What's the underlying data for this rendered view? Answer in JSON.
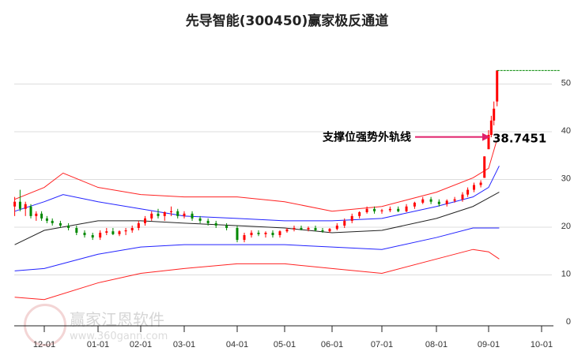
{
  "title": "先导智能(300450)赢家极反通道",
  "watermark": {
    "name": "赢家江恩软件",
    "url": "www.360gann.com"
  },
  "chart_data": {
    "type": "candlestick",
    "title": "先导智能(300450)赢家极反通道",
    "x_ticks": [
      "12-01",
      "01-01",
      "02-01",
      "03-01",
      "04-01",
      "05-01",
      "06-01",
      "07-01",
      "08-01",
      "09-01",
      "10-01"
    ],
    "y_ticks": [
      0,
      10,
      20,
      30,
      40,
      50
    ],
    "ylim": [
      0,
      55
    ],
    "x_unit": "months since 12-01",
    "annotation": {
      "label": "支撑位强势外轨线",
      "value": "38.7451"
    },
    "target_line": 53.5,
    "bands": {
      "upper_red": [
        [
          -0.55,
          26.5
        ],
        [
          0,
          29
        ],
        [
          0.35,
          32
        ],
        [
          1,
          29
        ],
        [
          2,
          27.5
        ],
        [
          3,
          27
        ],
        [
          4,
          27
        ],
        [
          5,
          26
        ],
        [
          6,
          24
        ],
        [
          7,
          25
        ],
        [
          8,
          28
        ],
        [
          8.7,
          31
        ],
        [
          9,
          33
        ],
        [
          9.15,
          38.7
        ]
      ],
      "upper_blue": [
        [
          -0.55,
          24
        ],
        [
          0,
          26
        ],
        [
          0.35,
          27.5
        ],
        [
          1,
          26
        ],
        [
          2,
          24.5
        ],
        [
          3,
          23
        ],
        [
          4,
          22.5
        ],
        [
          5,
          22
        ],
        [
          6,
          22
        ],
        [
          7,
          22.5
        ],
        [
          8,
          25
        ],
        [
          8.7,
          27
        ],
        [
          9,
          29
        ],
        [
          9.2,
          33.5
        ]
      ],
      "middle_black": [
        [
          -0.55,
          17
        ],
        [
          0,
          20
        ],
        [
          1,
          22
        ],
        [
          2,
          22
        ],
        [
          3,
          21.5
        ],
        [
          4,
          21
        ],
        [
          5,
          20.5
        ],
        [
          6,
          19.5
        ],
        [
          7,
          20
        ],
        [
          8,
          22.5
        ],
        [
          8.7,
          25
        ],
        [
          9.2,
          28
        ]
      ],
      "lower_blue": [
        [
          -0.55,
          11.5
        ],
        [
          0,
          12
        ],
        [
          1,
          15
        ],
        [
          2,
          16.5
        ],
        [
          3,
          17
        ],
        [
          4,
          17
        ],
        [
          5,
          17
        ],
        [
          6,
          16.5
        ],
        [
          7,
          16
        ],
        [
          8,
          18.5
        ],
        [
          8.7,
          20.5
        ],
        [
          9.2,
          20.5
        ]
      ],
      "lower_red": [
        [
          -0.55,
          6
        ],
        [
          0,
          5.5
        ],
        [
          1,
          9
        ],
        [
          2,
          11
        ],
        [
          3,
          12
        ],
        [
          4,
          13
        ],
        [
          5,
          13
        ],
        [
          6,
          12
        ],
        [
          7,
          11
        ],
        [
          8,
          14
        ],
        [
          8.7,
          16
        ],
        [
          9,
          15.5
        ],
        [
          9.2,
          14
        ]
      ]
    },
    "candles": [
      [
        -0.55,
        25,
        27,
        23,
        26
      ],
      [
        -0.45,
        26,
        28.5,
        24,
        24.5
      ],
      [
        -0.35,
        24.5,
        26,
        23,
        25.5
      ],
      [
        -0.25,
        25,
        25.5,
        22.5,
        23
      ],
      [
        -0.15,
        23,
        24,
        22,
        23.5
      ],
      [
        -0.05,
        23.5,
        24,
        22,
        22.5
      ],
      [
        0.05,
        22.5,
        23,
        21.5,
        22
      ],
      [
        0.15,
        22,
        22.5,
        21,
        21.5
      ],
      [
        0.3,
        21.5,
        22,
        20.5,
        21
      ],
      [
        0.45,
        21,
        21.5,
        20,
        20.5
      ],
      [
        0.6,
        20.5,
        21,
        19,
        19.5
      ],
      [
        0.75,
        19.5,
        20,
        18.5,
        19
      ],
      [
        0.9,
        19,
        19.5,
        18,
        18.5
      ],
      [
        1.05,
        18.5,
        20,
        18,
        19.5
      ],
      [
        1.2,
        19.5,
        20.5,
        19,
        19.8
      ],
      [
        1.35,
        19.8,
        20.5,
        19,
        19.2
      ],
      [
        1.5,
        19.2,
        20,
        18.8,
        19.8
      ],
      [
        1.65,
        19.8,
        20.5,
        19,
        20
      ],
      [
        1.8,
        20,
        21,
        19.5,
        20.5
      ],
      [
        1.95,
        20.5,
        22,
        20,
        21.5
      ],
      [
        2.1,
        21.5,
        23,
        21,
        22.5
      ],
      [
        2.25,
        22.5,
        24,
        22,
        23.5
      ],
      [
        2.4,
        23.5,
        24.5,
        22.5,
        23
      ],
      [
        2.55,
        23,
        24,
        22,
        23.8
      ],
      [
        2.7,
        23.8,
        25,
        23,
        24
      ],
      [
        2.85,
        24,
        24.5,
        22.5,
        23
      ],
      [
        3.0,
        23,
        24,
        22.5,
        23.5
      ],
      [
        3.15,
        23.5,
        24,
        22,
        22.5
      ],
      [
        3.3,
        22.5,
        23,
        21.5,
        22
      ],
      [
        3.45,
        22,
        22.5,
        21,
        21.5
      ],
      [
        3.6,
        21.5,
        22,
        20.5,
        21
      ],
      [
        3.8,
        21,
        21.5,
        20,
        20.5
      ],
      [
        4.0,
        20.5,
        21,
        17.5,
        18
      ],
      [
        4.15,
        18,
        19.5,
        17.5,
        19
      ],
      [
        4.3,
        19,
        20,
        18.5,
        19.5
      ],
      [
        4.45,
        19.5,
        20,
        18.8,
        19.2
      ],
      [
        4.6,
        19.2,
        19.8,
        18.5,
        19.5
      ],
      [
        4.75,
        19.5,
        20,
        18.5,
        19
      ],
      [
        4.9,
        19,
        20,
        18.5,
        19.8
      ],
      [
        5.05,
        19.8,
        20.5,
        19.5,
        20.2
      ],
      [
        5.2,
        20.2,
        21,
        19.8,
        20.5
      ],
      [
        5.35,
        20.5,
        21,
        20,
        20.2
      ],
      [
        5.5,
        20.2,
        20.8,
        19.8,
        20.5
      ],
      [
        5.65,
        20.5,
        21,
        19.8,
        20
      ],
      [
        5.8,
        20,
        20.5,
        19.5,
        19.8
      ],
      [
        5.95,
        19.8,
        20.5,
        19.5,
        20.3
      ],
      [
        6.1,
        20.3,
        21.5,
        20,
        21
      ],
      [
        6.25,
        21,
        22.5,
        20.5,
        22
      ],
      [
        6.4,
        22,
        23.5,
        21.5,
        23
      ],
      [
        6.55,
        23,
        24,
        22.5,
        23.8
      ],
      [
        6.7,
        23.8,
        25,
        23.5,
        24.5
      ],
      [
        6.85,
        24.5,
        25,
        23.5,
        24
      ],
      [
        7.0,
        24,
        24.5,
        23.5,
        24.2
      ],
      [
        7.15,
        24.2,
        25,
        23.8,
        24.5
      ],
      [
        7.3,
        24.5,
        25,
        23.8,
        24
      ],
      [
        7.45,
        24,
        25.5,
        23.8,
        25
      ],
      [
        7.6,
        25,
        26,
        24.5,
        25.8
      ],
      [
        7.75,
        25.8,
        27,
        25.5,
        26.5
      ],
      [
        7.9,
        26.5,
        27,
        25.5,
        26
      ],
      [
        8.05,
        26,
        26.5,
        25,
        25.5
      ],
      [
        8.2,
        25.5,
        26.5,
        25,
        26.2
      ],
      [
        8.35,
        26.2,
        27,
        25.8,
        26.5
      ],
      [
        8.5,
        26.5,
        28,
        26,
        27.5
      ],
      [
        8.6,
        27.5,
        29,
        27,
        28.5
      ],
      [
        8.72,
        28.5,
        30,
        28,
        29.5
      ],
      [
        8.85,
        29.5,
        30.5,
        29,
        30
      ],
      [
        8.92,
        31,
        35.5,
        31,
        35.5
      ],
      [
        9.0,
        37,
        41,
        37,
        40
      ],
      [
        9.05,
        40,
        44,
        39.5,
        43
      ],
      [
        9.1,
        43,
        47,
        42,
        45.5
      ],
      [
        9.16,
        47,
        53.5,
        46,
        53.5
      ]
    ]
  }
}
